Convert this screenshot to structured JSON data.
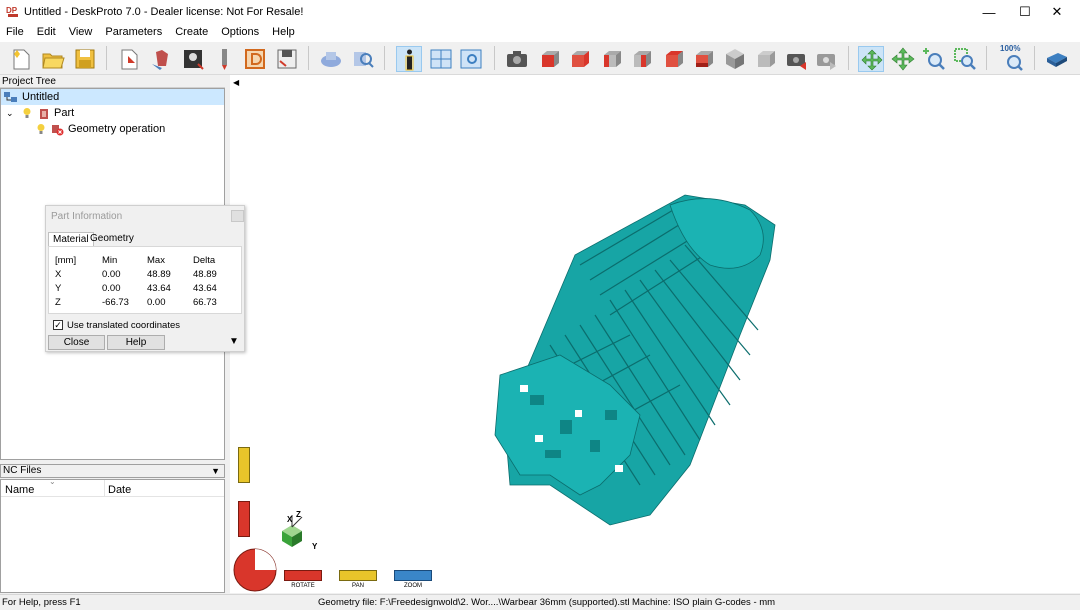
{
  "window": {
    "title": "Untitled - DeskProto 7.0 - Dealer license: Not For Resale!",
    "logo": "DP",
    "minimize": "—",
    "maximize": "☐",
    "close": "✕"
  },
  "menu": [
    "File",
    "Edit",
    "View",
    "Parameters",
    "Create",
    "Options",
    "Help"
  ],
  "toolbar_zoom_label": "100%",
  "project_tree": {
    "header": "Project Tree",
    "root": "Untitled",
    "part": "Part",
    "geometry_operation": "Geometry operation"
  },
  "part_information": {
    "title": "Part Information",
    "tabs": [
      "Material",
      "Geometry"
    ],
    "columns": [
      "[mm]",
      "Min",
      "Max",
      "Delta"
    ],
    "rows": [
      [
        "X",
        "0.00",
        "48.89",
        "48.89"
      ],
      [
        "Y",
        "0.00",
        "43.64",
        "43.64"
      ],
      [
        "Z",
        "-66.73",
        "0.00",
        "66.73"
      ]
    ],
    "checkbox_label": "Use translated coordinates",
    "checkbox_checked": true,
    "close_label": "Close",
    "help_label": "Help"
  },
  "nc_files": {
    "header": "NC Files",
    "columns": [
      "Name",
      "Date"
    ]
  },
  "viewport": {
    "axes": {
      "x": "X",
      "y": "Y",
      "z": "Z"
    },
    "controls": {
      "rotate": "ROTATE",
      "pan": "PAN",
      "zoom": "ZOOM"
    },
    "model_color": "#17a5a5"
  },
  "statusbar": {
    "help": "For Help, press F1",
    "geometry_file": "Geometry file: F:\\Freedesignwold\\2. Wor....\\Warbear 36mm (supported).stl",
    "machine": "Machine: ISO plain G-codes - mm"
  }
}
